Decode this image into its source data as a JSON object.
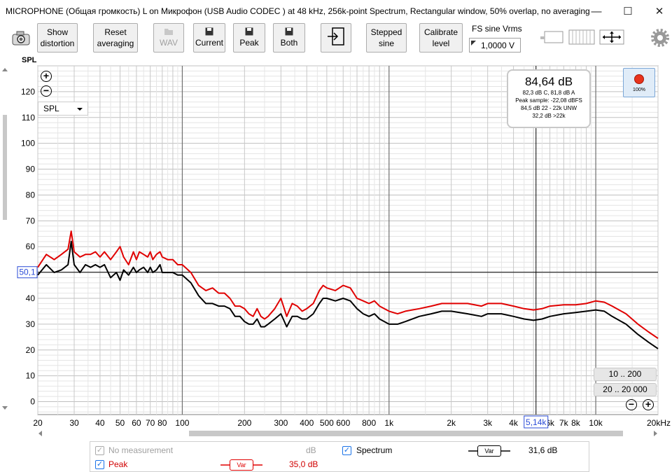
{
  "window": {
    "title": "MICROPHONE (Общая громкость) L on Микрофон (USB Audio CODEC ) at 48 kHz, 256k-point Spectrum, Rectangular window, 50% overlap, no averaging",
    "min_glyph": "—",
    "max_glyph": "☐",
    "close_glyph": "✕"
  },
  "toolbar": {
    "show_distortion": [
      "Show",
      "distortion"
    ],
    "reset_averaging": [
      "Reset",
      "averaging"
    ],
    "wav": "WAV",
    "current": "Current",
    "peak": "Peak",
    "both": "Both",
    "stepped_sine": [
      "Stepped",
      "sine"
    ],
    "calibrate_level": [
      "Calibrate",
      "level"
    ],
    "fs_label": "FS sine Vrms",
    "fs_value": "1,0000 V",
    "icons": [
      "camera-icon",
      "export-icon",
      "save-icon",
      "gear-icon",
      "move-arrows-icon"
    ]
  },
  "plot": {
    "y_axis_label": "SPL",
    "unit_selector": "SPL",
    "cursor_y_label": "50,1",
    "cursor_x_label": "5,14k",
    "info": {
      "main": "84,64 dB",
      "lines": [
        "82,3 dB C, 81,8 dB A",
        "Peak sample: -22,08 dBFS",
        "84,5 dB 22 - 22k UNW",
        "32,2 dB >22k"
      ]
    },
    "record_level": "100%",
    "range_buttons": [
      "10 .. 200",
      "20 .. 20 000"
    ],
    "colors": {
      "peak": "#e00000",
      "spectrum": "#000000",
      "grid": "#d4d4d4",
      "major_grid": "#707070"
    }
  },
  "legend": {
    "no_measurement": "No measurement",
    "no_measurement_unit": "dB",
    "peak_label": "Peak",
    "peak_var": "Var",
    "peak_value": "35,0 dB",
    "spectrum_label": "Spectrum",
    "spectrum_var": "Var",
    "spectrum_value": "31,6 dB"
  },
  "chart_data": {
    "type": "line",
    "title": "",
    "xlabel": "",
    "ylabel": "SPL",
    "x_scale": "log",
    "xlim": [
      20,
      20000
    ],
    "ylim": [
      -5,
      130
    ],
    "x_tick_labels": [
      "20",
      "30",
      "40",
      "50",
      "60",
      "70",
      "80",
      "100",
      "200",
      "300",
      "400",
      "500",
      "600",
      "800",
      "1k",
      "2k",
      "3k",
      "4k",
      "5,14k",
      "6k",
      "7k",
      "8k",
      "10k",
      "20kHz"
    ],
    "y_tick_labels": [
      "0",
      "10",
      "20",
      "30",
      "40",
      "50",
      "60",
      "70",
      "80",
      "90",
      "100",
      "110",
      "120"
    ],
    "grid": true,
    "cursor": {
      "x": 5140,
      "y": 50.1
    },
    "series": [
      {
        "name": "Peak",
        "color": "#e00000",
        "x": [
          20,
          22,
          24,
          26,
          28,
          29,
          30,
          32,
          34,
          36,
          38,
          40,
          42,
          45,
          48,
          50,
          52,
          55,
          58,
          60,
          62,
          65,
          68,
          70,
          72,
          75,
          78,
          80,
          85,
          90,
          95,
          100,
          110,
          120,
          130,
          140,
          150,
          160,
          170,
          180,
          190,
          200,
          210,
          220,
          230,
          240,
          250,
          260,
          280,
          300,
          320,
          340,
          360,
          380,
          400,
          430,
          460,
          480,
          500,
          550,
          600,
          650,
          700,
          750,
          800,
          850,
          900,
          1000,
          1100,
          1200,
          1400,
          1600,
          1800,
          2000,
          2400,
          2800,
          3000,
          3500,
          4000,
          4500,
          5000,
          5500,
          6000,
          7000,
          8000,
          9000,
          10000,
          11000,
          12000,
          14000,
          16000,
          18000,
          20000
        ],
        "y": [
          52,
          57,
          55,
          57,
          59,
          66,
          58,
          56,
          57,
          57,
          58,
          56,
          58,
          55,
          58,
          60,
          56,
          53,
          58,
          55,
          58,
          57,
          56,
          58,
          55,
          57,
          58,
          56,
          55,
          55,
          53,
          53,
          50,
          45,
          43,
          44,
          42,
          42,
          40,
          37,
          37,
          36,
          34,
          33,
          36,
          33,
          32,
          33,
          36,
          40,
          33,
          38,
          37,
          35,
          36,
          38,
          43,
          45,
          44,
          43,
          45,
          44,
          40,
          39,
          38,
          39,
          37,
          35,
          34,
          35,
          36,
          37,
          38,
          38,
          38,
          37,
          38,
          38,
          37,
          36,
          35.5,
          36,
          37,
          37.5,
          37.5,
          38,
          39,
          38.5,
          37,
          34,
          30,
          27,
          24.5
        ]
      },
      {
        "name": "Spectrum",
        "color": "#000000",
        "x": [
          20,
          22,
          24,
          26,
          28,
          29,
          30,
          32,
          34,
          36,
          38,
          40,
          42,
          45,
          48,
          50,
          52,
          55,
          58,
          60,
          62,
          65,
          68,
          70,
          72,
          75,
          78,
          80,
          85,
          90,
          95,
          100,
          110,
          120,
          130,
          140,
          150,
          160,
          170,
          180,
          190,
          200,
          210,
          220,
          230,
          240,
          250,
          260,
          280,
          300,
          320,
          340,
          360,
          380,
          400,
          430,
          460,
          480,
          500,
          550,
          600,
          650,
          700,
          750,
          800,
          850,
          900,
          1000,
          1100,
          1200,
          1400,
          1600,
          1800,
          2000,
          2400,
          2800,
          3000,
          3500,
          4000,
          4500,
          5000,
          5500,
          6000,
          7000,
          8000,
          9000,
          10000,
          11000,
          12000,
          14000,
          16000,
          18000,
          20000
        ],
        "y": [
          49,
          53,
          50,
          51,
          53,
          62,
          53,
          50,
          53,
          52,
          53,
          52,
          53,
          48,
          50,
          47,
          51,
          49,
          52,
          50,
          51,
          52,
          50,
          52,
          50,
          51,
          53,
          50,
          50,
          50,
          49,
          49,
          46,
          41,
          38,
          38,
          37,
          37,
          36,
          33,
          33,
          31,
          30,
          30,
          32,
          29,
          29,
          30,
          32,
          34,
          29,
          33,
          33,
          32,
          32,
          34,
          38,
          40,
          40,
          39,
          40,
          39,
          36,
          34,
          33,
          34,
          32,
          30,
          30,
          31,
          33,
          34,
          35,
          35,
          34,
          33,
          34,
          34,
          33,
          32,
          31.5,
          32,
          33,
          34,
          34.5,
          35,
          35.5,
          35,
          33,
          30,
          26,
          23,
          20.5
        ]
      }
    ]
  }
}
